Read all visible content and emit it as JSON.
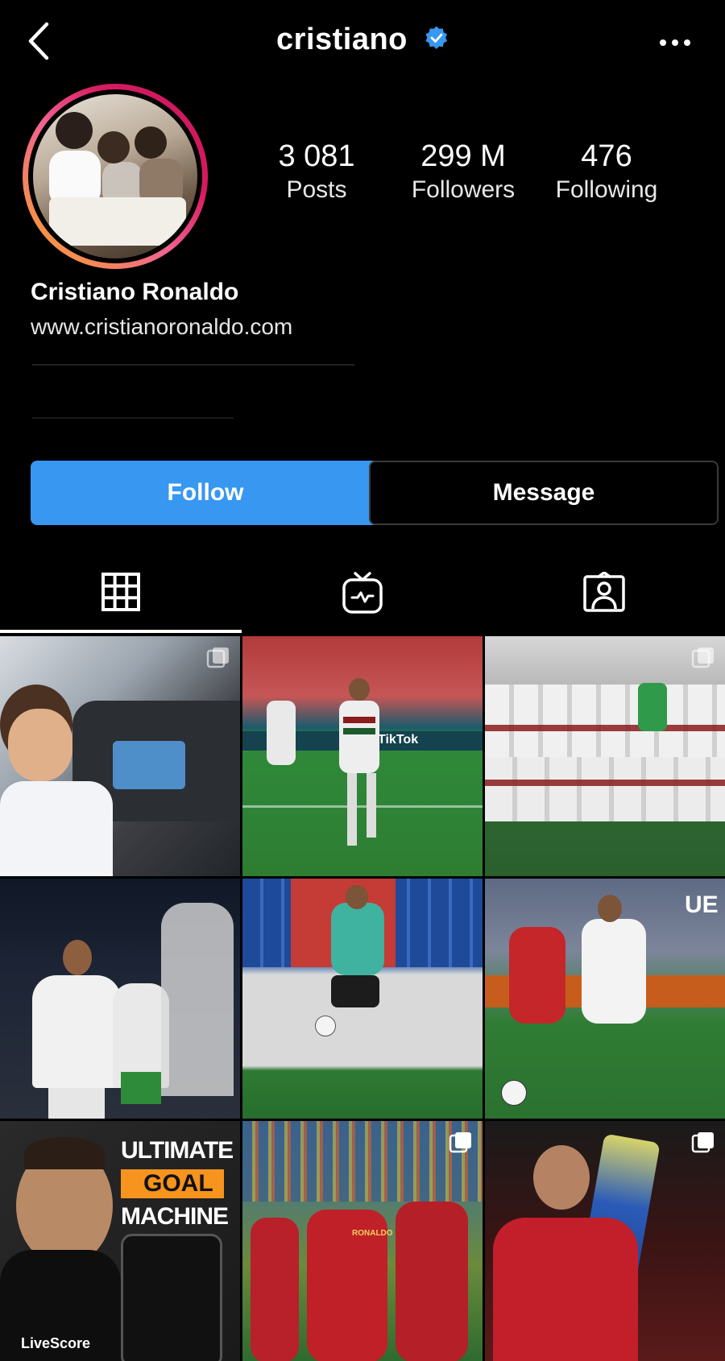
{
  "header": {
    "username": "cristiano",
    "verified_icon": "verified-badge-icon",
    "back_icon": "chevron-left-icon",
    "more_icon": "more-horizontal-icon"
  },
  "stats": {
    "posts_value": "3 081",
    "posts_label": "Posts",
    "followers_value": "299 M",
    "followers_label": "Followers",
    "following_value": "476",
    "following_label": "Following"
  },
  "bio": {
    "name": "Cristiano Ronaldo",
    "website": "www.cristianoronaldo.com"
  },
  "actions": {
    "follow_label": "Follow",
    "message_label": "Message"
  },
  "tabs": [
    {
      "icon": "grid-icon",
      "active": true
    },
    {
      "icon": "igtv-icon",
      "active": false
    },
    {
      "icon": "tagged-user-icon",
      "active": false
    }
  ],
  "posts": [
    {
      "id": 1,
      "multi": true
    },
    {
      "id": 2,
      "multi": false
    },
    {
      "id": 3,
      "multi": true
    },
    {
      "id": 4,
      "multi": false
    },
    {
      "id": 5,
      "multi": false
    },
    {
      "id": 6,
      "multi": false
    },
    {
      "id": 7,
      "multi": false,
      "text_lines": [
        "ULTIMATE",
        "GOAL",
        "MACHINE"
      ],
      "brand": "LiveScore"
    },
    {
      "id": 8,
      "multi": true
    },
    {
      "id": 9,
      "multi": true
    }
  ],
  "tile_texts": {
    "tiktok": "TikTok",
    "ue": "UE",
    "jersey": "RONALDO"
  },
  "colors": {
    "follow_button": "#3897f0",
    "verified": "#3897f0",
    "background": "#000000"
  }
}
